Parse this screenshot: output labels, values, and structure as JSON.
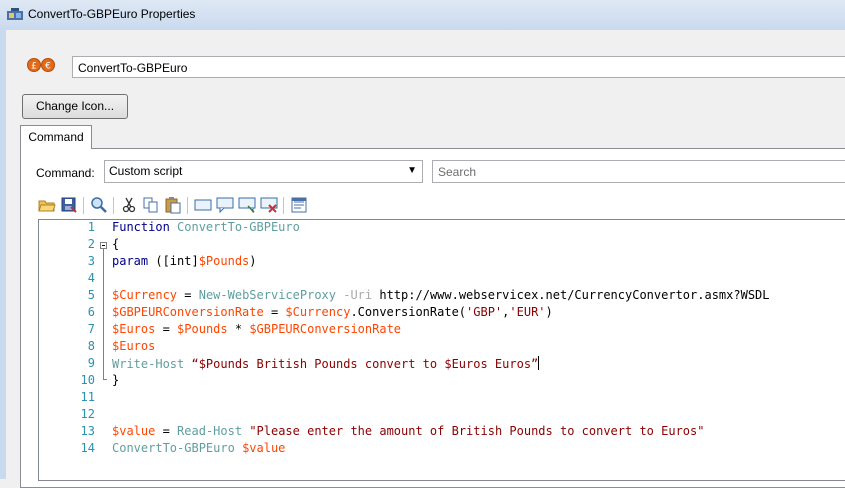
{
  "window": {
    "title": "ConvertTo-GBPEuro Properties"
  },
  "name_field": {
    "value": "ConvertTo-GBPEuro"
  },
  "change_icon_button": {
    "label": "Change Icon..."
  },
  "tabs": [
    {
      "label": "Command"
    }
  ],
  "command": {
    "label": "Command:",
    "selected": "Custom script",
    "search_placeholder": "Search"
  },
  "toolbar": {
    "icons": [
      "open-icon",
      "save-icon",
      "find-icon",
      "cut-icon",
      "copy-icon",
      "paste-icon",
      "comment-icon",
      "speech-icon",
      "speech2-icon",
      "delete-speech-icon",
      "properties-icon"
    ]
  },
  "code_lines": [
    {
      "n": "1",
      "tokens": [
        [
          "kw",
          "Function"
        ],
        [
          "plain",
          " "
        ],
        [
          "fn",
          "ConvertTo-GBPEuro"
        ]
      ]
    },
    {
      "n": "2",
      "tokens": [
        [
          "plain",
          "{"
        ]
      ]
    },
    {
      "n": "3",
      "tokens": [
        [
          "kw",
          "param"
        ],
        [
          "plain",
          " ([int]"
        ],
        [
          "var",
          "$Pounds"
        ],
        [
          "plain",
          ")"
        ]
      ]
    },
    {
      "n": "4",
      "tokens": []
    },
    {
      "n": "5",
      "tokens": [
        [
          "var",
          "$Currency"
        ],
        [
          "plain",
          " = "
        ],
        [
          "cmdlet",
          "New-WebServiceProxy"
        ],
        [
          "plain",
          " "
        ],
        [
          "op",
          "-Uri"
        ],
        [
          "plain",
          " http://www.webservicex.net/CurrencyConvertor.asmx?WSDL"
        ]
      ]
    },
    {
      "n": "6",
      "tokens": [
        [
          "var",
          "$GBPEURConversionRate"
        ],
        [
          "plain",
          " = "
        ],
        [
          "var",
          "$Currency"
        ],
        [
          "plain",
          ".ConversionRate("
        ],
        [
          "str",
          "'GBP'"
        ],
        [
          "plain",
          ","
        ],
        [
          "str",
          "'EUR'"
        ],
        [
          "plain",
          ")"
        ]
      ]
    },
    {
      "n": "7",
      "tokens": [
        [
          "var",
          "$Euros"
        ],
        [
          "plain",
          " = "
        ],
        [
          "var",
          "$Pounds"
        ],
        [
          "plain",
          " * "
        ],
        [
          "var",
          "$GBPEURConversionRate"
        ]
      ]
    },
    {
      "n": "8",
      "tokens": [
        [
          "var",
          "$Euros"
        ]
      ]
    },
    {
      "n": "9",
      "tokens": [
        [
          "cmdlet",
          "Write-Host"
        ],
        [
          "plain",
          " "
        ],
        [
          "str",
          "“$Pounds British Pounds convert to $Euros Euros”"
        ]
      ]
    },
    {
      "n": "10",
      "tokens": [
        [
          "plain",
          "}"
        ]
      ]
    },
    {
      "n": "11",
      "tokens": []
    },
    {
      "n": "12",
      "tokens": []
    },
    {
      "n": "13",
      "tokens": [
        [
          "var",
          "$value"
        ],
        [
          "plain",
          " = "
        ],
        [
          "cmdlet",
          "Read-Host"
        ],
        [
          "plain",
          " "
        ],
        [
          "str",
          "\"Please enter the amount of British Pounds to convert to Euros\""
        ]
      ]
    },
    {
      "n": "14",
      "tokens": [
        [
          "cmdlet",
          "ConvertTo-GBPEuro"
        ],
        [
          "plain",
          " "
        ],
        [
          "var",
          "$value"
        ]
      ]
    }
  ],
  "colors": {
    "keyword": "#00008b",
    "variable": "#ff4500",
    "cmdlet": "#5f9ea0",
    "string": "#8b0000",
    "line_number": "#2b91af"
  }
}
